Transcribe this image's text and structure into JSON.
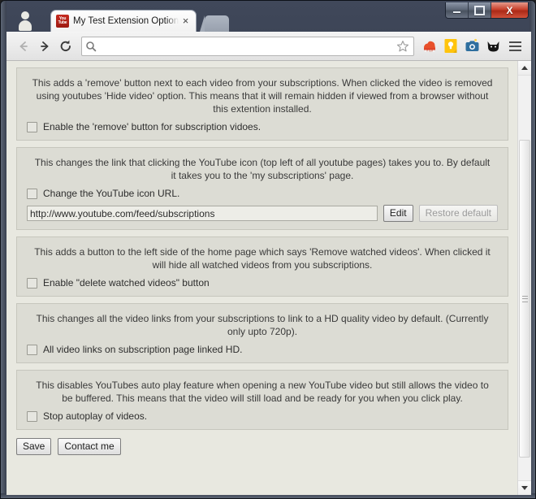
{
  "window": {
    "minimize_label": "Minimize",
    "maximize_label": "Maximize",
    "close_label": "X"
  },
  "tab": {
    "title": "My Test Extension Options",
    "favicon_text": "You Tube",
    "close_label": "×"
  },
  "toolbar": {
    "back_label": "Back",
    "forward_label": "Forward",
    "reload_label": "Reload",
    "omnibox_value": "",
    "omnibox_placeholder": "",
    "bookmark_label": "Bookmark this page",
    "extensions": [
      {
        "name": "cloud-extension-icon",
        "color": "#e8502b"
      },
      {
        "name": "lightbulb-extension-icon",
        "color": "#ffc40c"
      },
      {
        "name": "camera-extension-icon",
        "color": "#2f6f9f"
      },
      {
        "name": "cat-extension-icon",
        "color": "#1a1a1a"
      }
    ],
    "menu_label": "Customize and control"
  },
  "page": {
    "sections": [
      {
        "description": "This adds a 'remove' button next to each video from your subscriptions. When clicked the video is removed using youtubes 'Hide video' option. This means that it will remain hidden if viewed from a browser without this extention installed.",
        "checkbox_label": "Enable the 'remove' button for subscription vidoes.",
        "checked": false
      },
      {
        "description": "This changes the link that clicking the YouTube icon (top left of all youtube pages) takes you to. By default it takes you to the 'my subscriptions' page.",
        "checkbox_label": "Change the YouTube icon URL.",
        "checked": false,
        "url_value": "http://www.youtube.com/feed/subscriptions",
        "edit_label": "Edit",
        "restore_label": "Restore default",
        "restore_disabled": true
      },
      {
        "description": "This adds a button to the left side of the home page which says 'Remove watched videos'. When clicked it will hide all watched videos from you subscriptions.",
        "checkbox_label": "Enable \"delete watched videos\" button",
        "checked": false
      },
      {
        "description": "This changes all the video links from your subscriptions to link to a HD quality video by default. (Currently only upto 720p).",
        "checkbox_label": "All video links on subscription page linked HD.",
        "checked": false
      },
      {
        "description": "This disables YouTubes auto play feature when opening a new YouTube video but still allows the video to be buffered. This means that the video will still load and be ready for you when you click play.",
        "checkbox_label": "Stop autoplay of videos.",
        "checked": false
      }
    ],
    "save_label": "Save",
    "contact_label": "Contact me"
  },
  "scrollbar": {
    "up_label": "Scroll up",
    "down_label": "Scroll down"
  }
}
